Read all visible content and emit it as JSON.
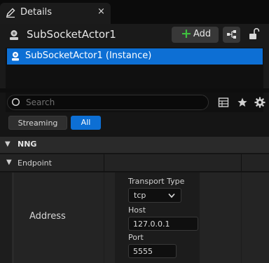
{
  "tab": {
    "title": "Details",
    "close": "×"
  },
  "actor": {
    "name": "SubSocketActor1"
  },
  "toolbar": {
    "add_label": "Add"
  },
  "instance_list": {
    "items": [
      {
        "label": "SubSocketActor1 (Instance)"
      }
    ]
  },
  "search": {
    "placeholder": "Search",
    "value": ""
  },
  "filters": {
    "streaming": "Streaming",
    "all": "All"
  },
  "category": {
    "label": "NNG"
  },
  "subcategory": {
    "label": "Endpoint"
  },
  "address": {
    "label": "Address",
    "transport_type_label": "Transport Type",
    "transport_type_value": "tcp",
    "host_label": "Host",
    "host_value": "127.0.0.1",
    "port_label": "Port",
    "port_value": "5555"
  },
  "colors": {
    "accent": "#0d6fd4",
    "add_plus": "#3fbf3f"
  },
  "icons": [
    "pencil-icon",
    "actor-icon",
    "plus-icon",
    "blueprint-icon",
    "unlock-icon",
    "search-icon",
    "table-icon",
    "star-icon",
    "gear-icon",
    "chevron-down-icon"
  ]
}
